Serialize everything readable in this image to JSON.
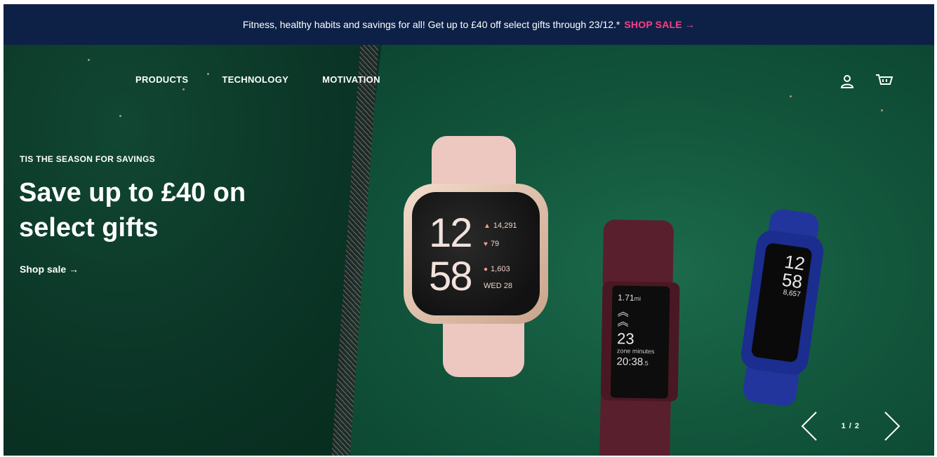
{
  "promo": {
    "message": "Fitness, healthy habits and savings for all! Get up to £40 off select gifts through 23/12.*",
    "cta": "SHOP SALE →",
    "cta_color": "#ff3f86",
    "bg_color": "#0d2147"
  },
  "nav": {
    "items": [
      {
        "label": "PRODUCTS"
      },
      {
        "label": "TECHNOLOGY"
      },
      {
        "label": "MOTIVATION"
      }
    ],
    "icons": [
      "account-icon",
      "cart-icon"
    ]
  },
  "hero": {
    "eyebrow": "TIS THE SEASON FOR SAVINGS",
    "headline": "Save up to £40 on select gifts",
    "cta": "Shop sale →"
  },
  "watches": {
    "versa": {
      "hour": "12",
      "minute": "58",
      "steps": "14,291",
      "heart_rate": "79",
      "calories": "1,603",
      "date": "WED 28"
    },
    "charge": {
      "distance": "1.71",
      "distance_unit": "mi",
      "zone_minutes": "23",
      "zone_label": "zone minutes",
      "time": "20:38",
      "time_fraction": ".5"
    },
    "ace": {
      "hour": "12",
      "minute": "58",
      "steps": "8,657"
    }
  },
  "carousel": {
    "pager": "1 / 2"
  }
}
